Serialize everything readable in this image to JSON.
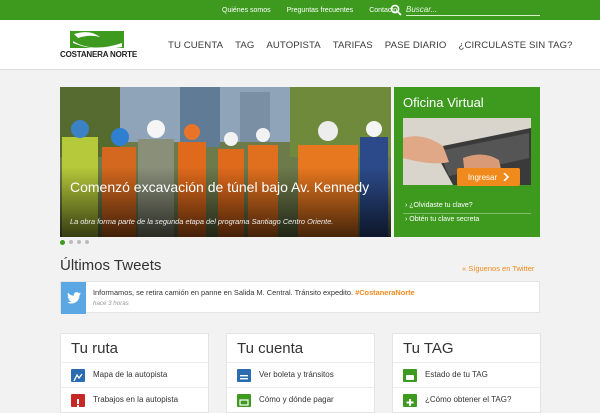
{
  "topbar": {
    "links": [
      "Quiénes somos",
      "Preguntas frecuentes",
      "Contacto"
    ],
    "search_placeholder": "Buscar..."
  },
  "header": {
    "logo_text": "COSTANERA NORTE",
    "nav": [
      "TU CUENTA",
      "TAG",
      "AUTOPISTA",
      "TARIFAS",
      "PASE DIARIO",
      "¿CIRCULASTE SIN TAG?"
    ]
  },
  "hero": {
    "title": "Comenzó excavación de túnel bajo Av. Kennedy",
    "subtitle": "La obra forma parte de la segunda etapa del programa Santiago Centro Oriente."
  },
  "oficina": {
    "title": "Oficina Virtual",
    "button": "Ingresar",
    "links": [
      "¿Olvidaste tu clave?",
      "Obtén tu clave secreta"
    ]
  },
  "tweets": {
    "heading": "Últimos Tweets",
    "follow": "« Síguenos en Twitter",
    "text": "Informamos, se retira camión en panne en Salida M. Central. Tránsito expedito.",
    "hashtag": "#CostaneraNorte",
    "time": "hace 3 horas"
  },
  "cards": [
    {
      "title": "Tu ruta",
      "items": [
        "Mapa de la autopista",
        "Trabajos en la autopista"
      ]
    },
    {
      "title": "Tu cuenta",
      "items": [
        "Ver boleta y tránsitos",
        "Cómo y dónde pagar"
      ]
    },
    {
      "title": "Tu TAG",
      "items": [
        "Estado de tu TAG",
        "¿Cómo obtener el TAG?"
      ]
    }
  ],
  "colors": {
    "brand": "#3d9a1f",
    "accent": "#f08a1d",
    "twitter": "#5aa7e3",
    "card_icon_blue": "#2b6cb0",
    "card_icon_red": "#c62828"
  }
}
